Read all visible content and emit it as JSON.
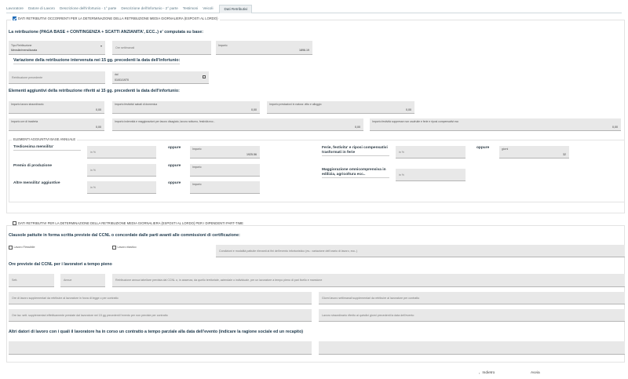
{
  "tabs": [
    "Lavoratore",
    "Datore di Lavoro",
    "Descrizione dell'infortunio - 1° parte",
    "Descrizione dell'infortunio - 2° parte",
    "Testimoni",
    "Veicoli",
    "Dati Retributivi"
  ],
  "section1": {
    "legend": "DATI RETRIBUTIVI OCCORRENTI PER LA DETERMINAZIONE DELLA RETRIBUZIONE MEDIA GIORNALIERA (ESPOSTI AL LORDO)",
    "title_base": "La retribuzione (PAGA BASE + CONTINGENZA + SCATTI ANZIANITA', ECC..) e' computata su base:",
    "tipo_label": "Tipo Retribuzione",
    "tipo_value": "Mensile/mensilizzata",
    "ore_placeholder": "Ore settimanali",
    "importo_label": "Importo",
    "importo_value": "1896.19",
    "variazione_title": "Variazione della retribuzione intervenuta nei 15 gg. precedenti la data dell'infortunio:",
    "retr_label": "Retribuzione precedente",
    "dal_label": "dal",
    "dal_value": "01/01/1970",
    "elementi_title": "Elementi aggiuntivi della retribuzione riferiti ai 15 gg. precedenti la data dell'infortunio:",
    "row1": [
      {
        "label": "Importo lavoro straordinario",
        "value": "0,00"
      },
      {
        "label": "Importo festività/ sabati di domenica",
        "value": "0,00"
      },
      {
        "label": "Importo prestazioni in natura: vitto e alloggio",
        "value": "0,00"
      }
    ],
    "row2": [
      {
        "label": "Importo ore di trasferta",
        "value": "0,00"
      },
      {
        "label": "Importo indennità e maggiorazioni per lavoro disagiato, lavoro notturno, festività ecc..",
        "value": "0,00"
      },
      {
        "label": "Importo festività soppresse non usufruite e ferie e riposi compensativi ecc",
        "value": "0,00"
      }
    ],
    "annuali": {
      "legend": "ELEMENTI AGGIUNTIVI BASE ANNUALE",
      "tredicesima": "Tredicesima mensilita'",
      "premio": "Premio di produzione",
      "altre": "Altre mensilita' aggiuntive",
      "oppure": "oppure",
      "pct_placeholder": "in %",
      "importo_label": "Importo",
      "tredicesima_value": "1925.56",
      "ferie": "Ferie, festivita' e riposi compensativi trasformati in ferie",
      "maggiorazione": "Maggiorazione omnicomprensiva in edilizia, agricoltura ecc..",
      "giorni_label": "giorni",
      "giorni_value": "32"
    }
  },
  "section2": {
    "legend": "DATI RETRIBUTIVI PER LA DETERMINAZIONE DELLA RETRIBUZIONE MEDIA GIORNALIERA (ESPOSTI AL LORDO) PER I DIPENDENTI PART-TIME",
    "clausole_title": "Clausole pattuite in forma scritta previste dal CCNL o concordate dalle parti avanti alle commissioni di certificazione:",
    "lavoro_flessibile": "Lavoro Flessibile",
    "lavoro_elastico": "Lavoro elastico",
    "condizioni_placeholder": "Condizioni e modalità pattuite rilevanti ai fini dell'evento infortunistico (es.: variazione dell'orario di lavoro, ecc..)",
    "ore_title": "Ore previste dal CCNL per i lavoratori a tempo pieno",
    "sett_placeholder": "Sett.",
    "annue_placeholder": "Annue",
    "retribuzione_placeholder": "Retribuzione annua tabellare prevista dal CCNL o, in assenza, da quello territoriale, aziendale o individuale, per un lavoratore a tempo pieno di pari livello e mansione",
    "ore_suppl_placeholder": "Ore di lavoro supplementari da retribuire al lavoratore in forza di legge o per contratto",
    "giorni_suppl_placeholder": "Giorni lavoro settimanali supplementari da retribuire al lavoratore per contratto",
    "ore_sett_placeholder": "Ore lav. sett. supplementari effettivamente prestate dal lavoratore nei 15 gg precedenti l'evento per non previste per contratto",
    "lavoro_straord_placeholder": "Lavoro straordinario riferito ai quindici giorni precedenti la data dell'evento",
    "altri_title": "Altri datori di lavoro con i quali il lavoratore ha in corso un contratto a tempo parziale alla data dell'evento (indicare la ragione sociale ed un recapito)"
  },
  "footer": {
    "back_label": "Indietro",
    "next_label": "Avvia"
  }
}
